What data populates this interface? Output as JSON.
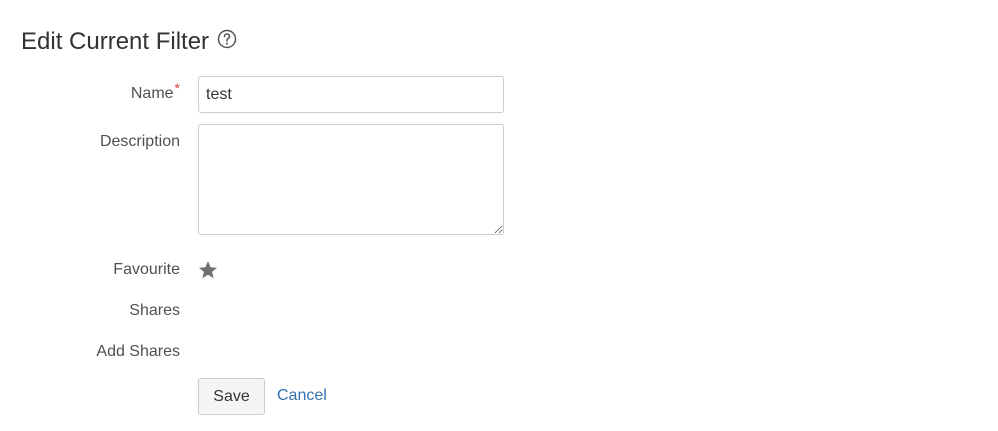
{
  "header": {
    "title": "Edit Current Filter",
    "help_icon": "question-circle-icon"
  },
  "form": {
    "name": {
      "label": "Name",
      "required_mark": "*",
      "value": "test"
    },
    "description": {
      "label": "Description",
      "value": ""
    },
    "favourite": {
      "label": "Favourite",
      "icon": "star-icon",
      "state": "favourite"
    },
    "shares": {
      "label": "Shares"
    },
    "add_shares": {
      "label": "Add Shares"
    }
  },
  "actions": {
    "save_label": "Save",
    "cancel_label": "Cancel"
  },
  "colors": {
    "text": "#333333",
    "label": "#505050",
    "required": "#d04437",
    "link": "#3572b0",
    "star": "#707070",
    "border": "#cccccc"
  }
}
